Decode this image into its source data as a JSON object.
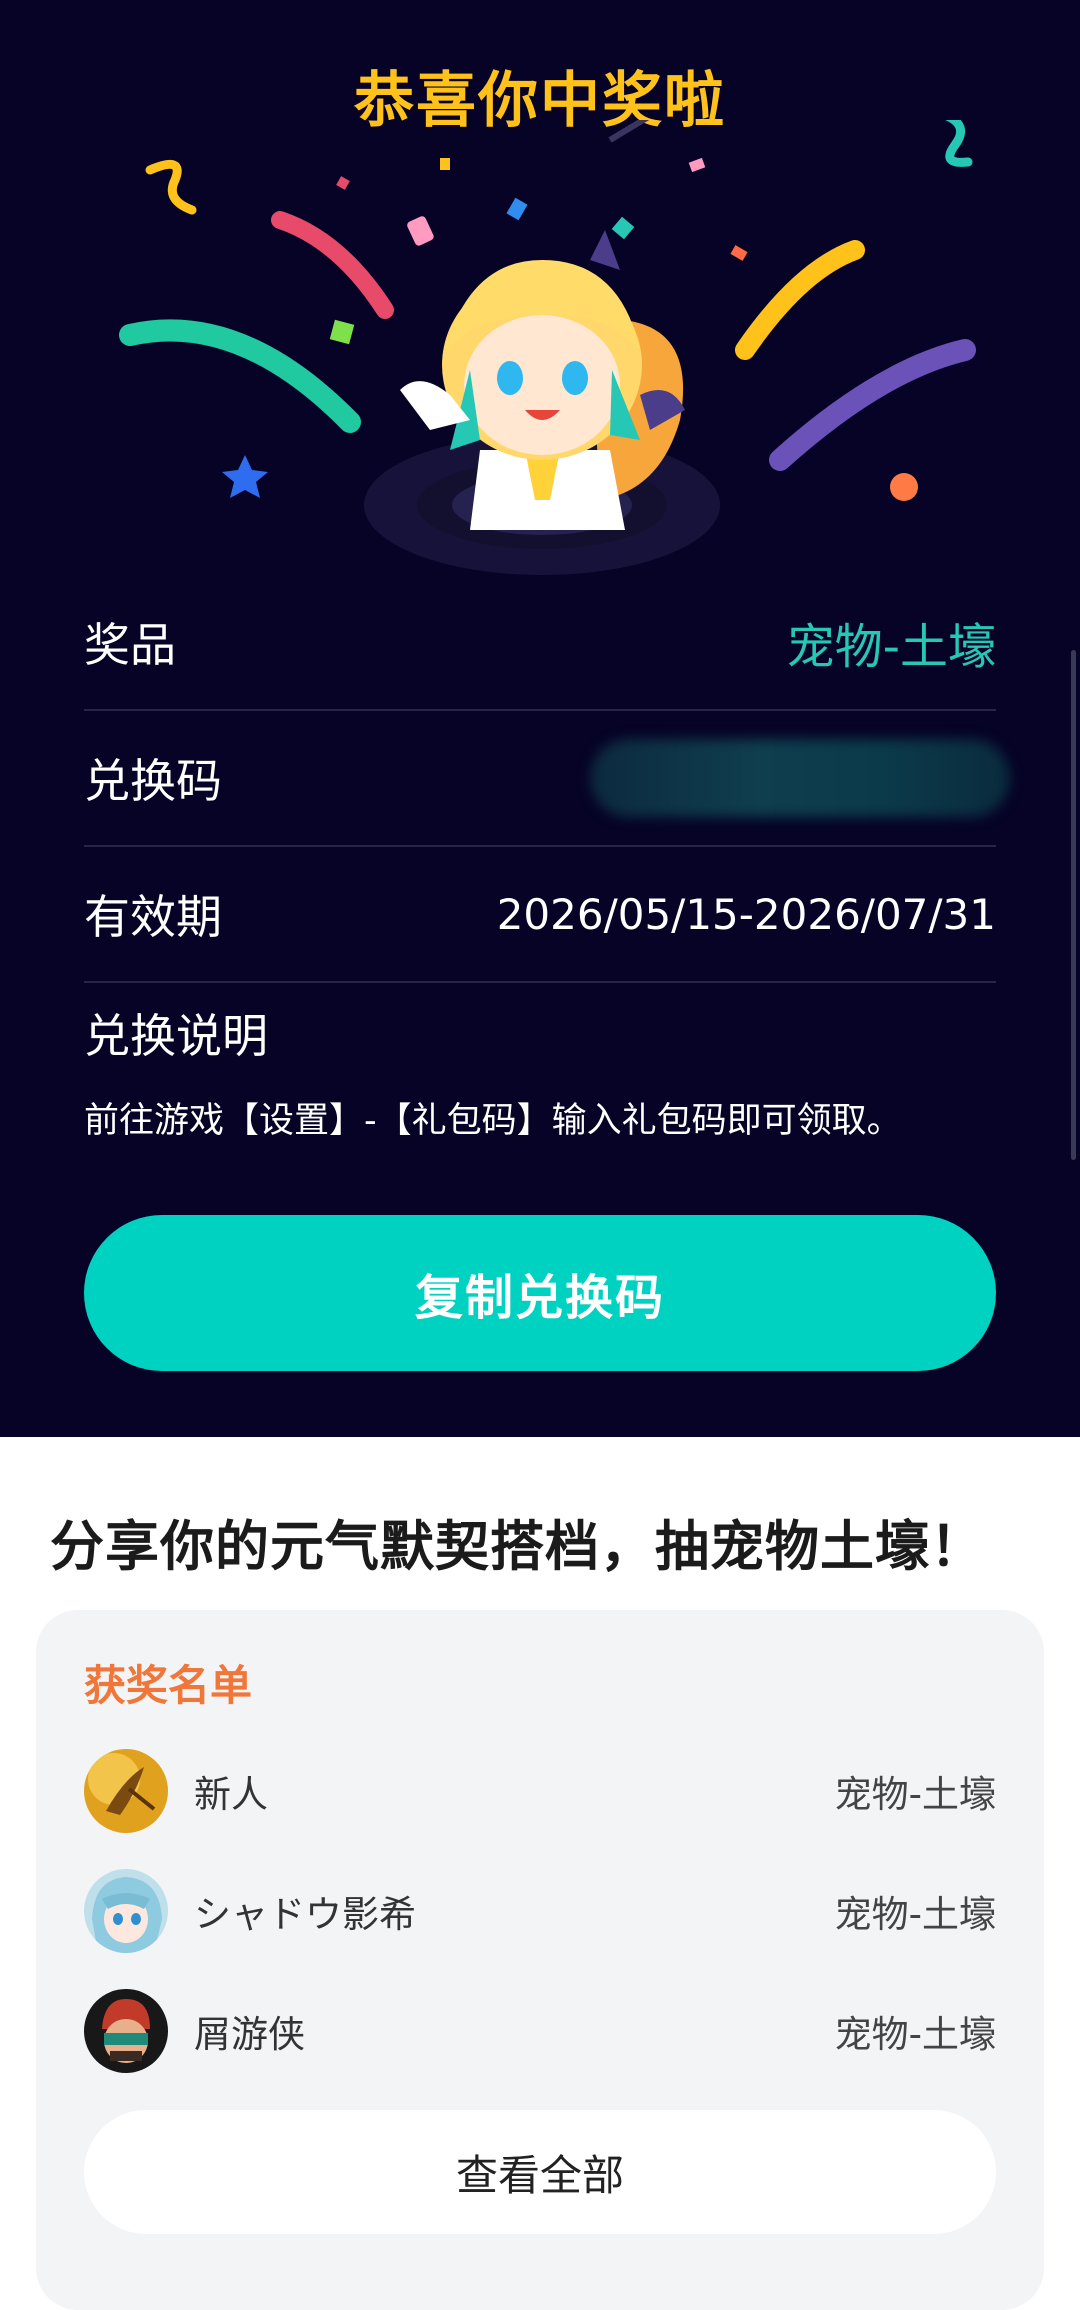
{
  "colors": {
    "background_top": "#060326",
    "title": "#ffc21a",
    "accent": "#26c8b5",
    "button": "#00d2c2",
    "winners_head": "#f0763a"
  },
  "header": {
    "title": "恭喜你中奖啦"
  },
  "prize_info": {
    "rows": [
      {
        "label": "奖品",
        "value": "宠物-土壕"
      },
      {
        "label": "兑换码",
        "value": ""
      },
      {
        "label": "有效期",
        "value": "2026/05/15-2026/07/31"
      }
    ],
    "instructions_label": "兑换说明",
    "instructions_text": "前往游戏【设置】-【礼包码】输入礼包码即可领取。"
  },
  "copy_button": {
    "label": "复制兑换码"
  },
  "share": {
    "title": "分享你的元气默契搭档，抽宠物土壕！"
  },
  "winners": {
    "heading": "获奖名单",
    "list": [
      {
        "name": "新人",
        "prize": "宠物-土壕",
        "avatar": "golden-feather-avatar"
      },
      {
        "name": "シャドウ影希",
        "prize": "宠物-土壕",
        "avatar": "anime-girl-avatar"
      },
      {
        "name": "屑游侠",
        "prize": "宠物-土壕",
        "avatar": "ninja-avatar"
      }
    ],
    "view_all_label": "查看全部"
  }
}
